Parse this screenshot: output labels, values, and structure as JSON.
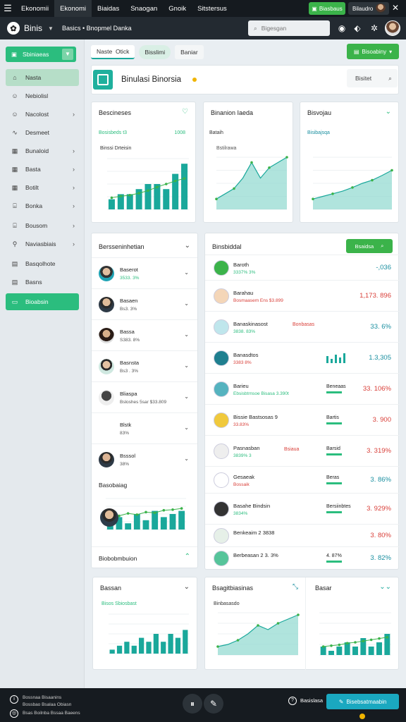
{
  "topbar": {
    "tabs": [
      "Ekonomii",
      "Ekonomi",
      "Biaidas",
      "Snaogan",
      "Gnoik",
      "Sitstersus"
    ],
    "green_btn": "Biasbaus",
    "user": "Bilaudro"
  },
  "header": {
    "brand": "Binis",
    "breadcrumb": "Basics • Bnopmel Danka",
    "search_placeholder": "Bigesgan"
  },
  "sidebar": {
    "top": "Sbiniaeas",
    "items": [
      {
        "label": "Nasta",
        "icon": "home-icon"
      },
      {
        "label": "Nebiolisl",
        "icon": "user-icon"
      },
      {
        "label": "Nacolost",
        "icon": "user-icon"
      },
      {
        "label": "Desmeet",
        "icon": "chart-icon"
      },
      {
        "label": "Bunaloid",
        "icon": "grid-icon"
      },
      {
        "label": "Basta",
        "icon": "grid-icon"
      },
      {
        "label": "Botilt",
        "icon": "grid-icon"
      },
      {
        "label": "Bonka",
        "icon": "bank-icon"
      },
      {
        "label": "Bousom",
        "icon": "bank-icon"
      },
      {
        "label": "Naviasbiais",
        "icon": "pin-icon"
      },
      {
        "label": "Basqolhote",
        "icon": "file-icon"
      },
      {
        "label": "Basns",
        "icon": "file-icon"
      },
      {
        "label": "Bioabsin",
        "icon": "folder-icon"
      }
    ]
  },
  "main": {
    "tabs": [
      "Naste",
      "Otick",
      "Bisslimi",
      "Baniar"
    ],
    "export": "Bisoabiny",
    "title": "Binulasi Binorsia",
    "title_search": "Bisitet",
    "cards": [
      {
        "title": "Bescineses",
        "legend": "Bosisbeds  t3",
        "legend_r": "1008",
        "sub": "Binssi Drteisin"
      },
      {
        "title": "Binanion Iaeda",
        "legend": "Bataih",
        "sub": "Bstilrawa"
      },
      {
        "title": "Bisvojau",
        "legend": "Bisibajsqa",
        "sub": ""
      }
    ],
    "list_title": "Bersseninhetian",
    "list_rows": [
      {
        "name": "Baserot",
        "sub": "3533.  3%"
      },
      {
        "name": "Basaen",
        "sub": "Bs3.  3%"
      },
      {
        "name": "Bassa",
        "sub": "S383.  8%"
      },
      {
        "name": "Basnsta",
        "sub": "Bs3 . 3%"
      },
      {
        "name": "Bliaspa",
        "sub": "Bsloshes 5sar  $33.809"
      },
      {
        "name": "Blstk",
        "sub": "83%"
      },
      {
        "name": "Bsssol",
        "sub": "38%"
      }
    ],
    "list_footer1": "Basobaiag",
    "list_footer2": "Biobobmbuion",
    "stats_title": "Binsbiddal",
    "stats_btn": "Bsaidsa",
    "stats_rows": [
      {
        "name": "Baroth",
        "sub": "3337%  3%",
        "val": "-,036",
        "val_cls": "teal",
        "av": "#3bb34a"
      },
      {
        "name": "Barahau",
        "sub": "Bosmaasem Ens  $3.899",
        "val": "1,173.  896",
        "val_cls": "red",
        "av": "#f4d6b8"
      },
      {
        "name": "Banaskinasost",
        "sub": "3838.  83%",
        "val": "33.  6%",
        "val_cls": "teal",
        "av": "#bfe6ec",
        "mid": "Bonbasas"
      },
      {
        "name": "Banasdtos",
        "sub": "3383  8%",
        "val": "1.3,305",
        "val_cls": "teal",
        "av": "#1f7f8f"
      },
      {
        "name": "Barieu",
        "sub": "Ebsisbtrnsoe  Bisasa  3.390t",
        "val": "33.  106%",
        "val_cls": "red",
        "av": "#55b3bf",
        "mid": "Beneaas"
      },
      {
        "name": "Bissie  Bastsosas  9",
        "sub": "33.83%",
        "val": "3.  900",
        "val_cls": "red",
        "av": "#f0c93c",
        "mid": "Bartis"
      },
      {
        "name": "Pasnasban",
        "sub": "3839%  3",
        "val": "3.  319%",
        "val_cls": "red",
        "av": "#eee",
        "mid": "Barsid",
        "tag": "Bsiaua"
      },
      {
        "name": "Gesaeak",
        "sub": "Bossaik",
        "val": "3.  86%",
        "val_cls": "teal",
        "av": "#fff",
        "mid": "Beras"
      },
      {
        "name": "Basahe  Bindsin",
        "sub": "3834%",
        "val": "3.  929%",
        "val_cls": "red",
        "av": "#333",
        "mid": "Bersiinbtes"
      },
      {
        "name": "Benkeaim  2  3838",
        "sub": "",
        "val": "3.  80%",
        "val_cls": "red",
        "av": "#e6f0e8"
      },
      {
        "name": "Berbeasan  2  3.  3%",
        "sub": "",
        "val": "3.  82%",
        "val_cls": "teal",
        "av": "#56c49a",
        "mid": "4.  87%"
      }
    ],
    "bottom_cards": [
      {
        "title": "Bassan",
        "legend": "Bisos  Sbiosbast"
      },
      {
        "title": "Bsagitbiasinas",
        "legend": "Binbasasdo"
      },
      {
        "title": "Basar",
        "legend": ""
      }
    ]
  },
  "footer": {
    "lines": [
      "Bossnaa  Bisaanins",
      "Bossbao  Bsalaa  Obiasn",
      "Bsas  Boilnba  Bssaa  Baeens"
    ],
    "help": "Basislasa",
    "cta": "Bisebsatmaabin"
  },
  "chart_data": [
    {
      "type": "bar",
      "title": "Bescineses",
      "values": [
        2,
        3,
        3,
        4,
        5,
        5,
        4,
        7,
        9
      ],
      "line": [
        2.3,
        2.6,
        2.8,
        3.2,
        3.7,
        4.4,
        5.0,
        5.6,
        6.1
      ],
      "ylim": [
        0,
        10
      ]
    },
    {
      "type": "area",
      "title": "Binanion Iaeda",
      "values": [
        2,
        3,
        4,
        6,
        9,
        6,
        8,
        9,
        10
      ],
      "ylim": [
        0,
        10
      ]
    },
    {
      "type": "area",
      "title": "Bisvojau",
      "values": [
        2,
        2.5,
        3,
        3.5,
        4.2,
        5,
        5.6,
        6.5,
        7.5
      ],
      "ylim": [
        0,
        10
      ]
    },
    {
      "type": "bar",
      "title": "Basobaiag",
      "values": [
        3,
        4,
        2,
        5,
        3,
        6,
        4,
        5,
        6
      ],
      "line": [
        4,
        4.4,
        5.2,
        4.8,
        5.6,
        5.4,
        6.2,
        6.4,
        6.8
      ],
      "ylim": [
        0,
        10
      ]
    },
    {
      "type": "bar",
      "title": "Bassan",
      "values": [
        1,
        2,
        3,
        2,
        4,
        3,
        5,
        3,
        5,
        4,
        6
      ],
      "ylim": [
        0,
        10
      ]
    },
    {
      "type": "area",
      "title": "Bsagitbiasinas",
      "values": [
        2,
        2.5,
        3.5,
        5,
        7,
        6,
        7.5,
        8.5,
        9.5
      ],
      "ylim": [
        0,
        10
      ]
    },
    {
      "type": "bar",
      "title": "Basar",
      "values": [
        2,
        1,
        2,
        3,
        2,
        4,
        2,
        3,
        5
      ],
      "line": [
        2,
        2.2,
        2.4,
        2.8,
        3,
        3.3,
        3.6,
        3.9,
        4.2
      ],
      "ylim": [
        0,
        10
      ]
    }
  ]
}
